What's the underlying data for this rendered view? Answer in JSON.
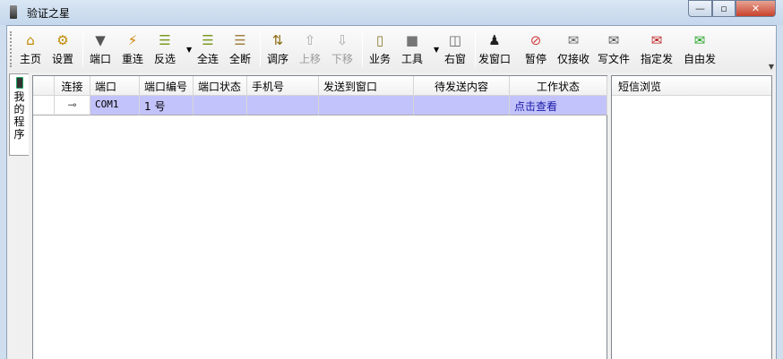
{
  "window": {
    "title": "验证之星",
    "min": "—",
    "max": "▫",
    "close": "✕"
  },
  "toolbar": [
    {
      "label": "主页",
      "icon": "home-icon",
      "glyph": "⌂",
      "color": "#c08a00"
    },
    {
      "label": "设置",
      "icon": "settings-icon",
      "glyph": "⚙",
      "color": "#c08a00"
    },
    {
      "label": "端口",
      "icon": "port-icon",
      "glyph": "▼",
      "color": "#555"
    },
    {
      "label": "重连",
      "icon": "reconnect-icon",
      "glyph": "⚡",
      "color": "#d08000"
    },
    {
      "label": "反选",
      "icon": "invert-select-icon",
      "glyph": "☰",
      "color": "#7a9a20"
    },
    {
      "label": "全连",
      "icon": "connect-all-icon",
      "glyph": "☰",
      "color": "#7a9a20"
    },
    {
      "label": "全断",
      "icon": "disconnect-all-icon",
      "glyph": "☰",
      "color": "#a08040"
    },
    {
      "label": "调序",
      "icon": "reorder-icon",
      "glyph": "⇅",
      "color": "#8a6a10"
    },
    {
      "label": "上移",
      "icon": "move-up-icon",
      "glyph": "⇧",
      "color": "#aaa",
      "disabled": true
    },
    {
      "label": "下移",
      "icon": "move-down-icon",
      "glyph": "⇩",
      "color": "#aaa",
      "disabled": true
    },
    {
      "label": "业务",
      "icon": "business-icon",
      "glyph": "▯",
      "color": "#8a7a30"
    },
    {
      "label": "工具",
      "icon": "tools-icon",
      "glyph": "■",
      "color": "#777"
    },
    {
      "label": "右窗",
      "icon": "right-window-icon",
      "glyph": "◫",
      "color": "#666"
    },
    {
      "label": "发窗口",
      "icon": "send-window-icon",
      "glyph": "♟",
      "color": "#222"
    },
    {
      "label": "暂停",
      "icon": "pause-icon",
      "glyph": "⊘",
      "color": "#d04040"
    },
    {
      "label": "仅接收",
      "icon": "receive-only-icon",
      "glyph": "✉",
      "color": "#666"
    },
    {
      "label": "写文件",
      "icon": "write-file-icon",
      "glyph": "✉",
      "color": "#555"
    },
    {
      "label": "指定发",
      "icon": "send-specified-icon",
      "glyph": "✉",
      "color": "#c02020"
    },
    {
      "label": "自由发",
      "icon": "send-free-icon",
      "glyph": "✉",
      "color": "#20a020"
    }
  ],
  "sidetab": {
    "label": "我的程序"
  },
  "grid": {
    "columns": [
      "连接",
      "端口",
      "端口编号",
      "端口状态",
      "手机号",
      "发送到窗口",
      "待发送内容",
      "工作状态"
    ],
    "rows": [
      {
        "connect": "⊸",
        "port": "COM1",
        "port_no": "1 号",
        "port_status": "",
        "phone": "",
        "send_to": "",
        "pending": "",
        "status": "点击查看"
      }
    ]
  },
  "right_panel": {
    "title": "短信浏览"
  }
}
